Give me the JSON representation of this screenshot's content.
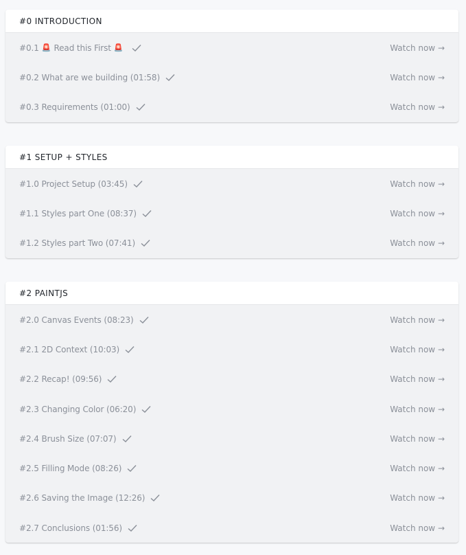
{
  "sections": [
    {
      "title": "#0 INTRODUCTION",
      "lessons": [
        {
          "prefix": "#0.1",
          "title": "Read this First",
          "icon": "siren-icon"
        },
        {
          "title": "#0.2 What are we building (01:58)"
        },
        {
          "title": "#0.3 Requirements (01:00)"
        }
      ]
    },
    {
      "title": "#1 SETUP + STYLES",
      "lessons": [
        {
          "title": "#1.0 Project Setup (03:45)"
        },
        {
          "title": "#1.1 Styles part One (08:37)"
        },
        {
          "title": "#1.2 Styles part Two (07:41)"
        }
      ]
    },
    {
      "title": "#2 PAINTJS",
      "lessons": [
        {
          "title": "#2.0 Canvas Events (08:23)"
        },
        {
          "title": "#2.1 2D Context (10:03)"
        },
        {
          "title": "#2.2 Recap! (09:56)"
        },
        {
          "title": "#2.3 Changing Color (06:20)"
        },
        {
          "title": "#2.4 Brush Size (07:07)"
        },
        {
          "title": "#2.5 Filling Mode (08:26)"
        },
        {
          "title": "#2.6 Saving the Image (12:26)"
        },
        {
          "title": "#2.7 Conclusions (01:56)"
        }
      ]
    }
  ],
  "watch_label": "Watch now →",
  "siren_glyph": "🚨",
  "check_icon": "check-icon",
  "colors": {
    "text_muted": "#8b9099",
    "header_text": "#1f2329",
    "section_bg": "#f1f2f4",
    "page_bg": "#f7f8fa"
  }
}
